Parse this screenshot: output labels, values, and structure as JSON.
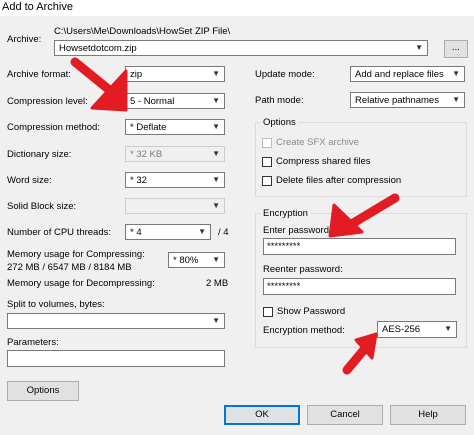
{
  "window": {
    "title": "Add to Archive"
  },
  "archive": {
    "label": "Archive:",
    "path": "C:\\Users\\Me\\Downloads\\HowSet ZIP File\\",
    "filename": "Howsetdotcom.zip",
    "browse_label": "..."
  },
  "left": {
    "format": {
      "label": "Archive format:",
      "value": "zip"
    },
    "level": {
      "label": "Compression level:",
      "value": "5 - Normal"
    },
    "method": {
      "label": "Compression method:",
      "value": "* Deflate"
    },
    "dict": {
      "label": "Dictionary size:",
      "value": "* 32 KB"
    },
    "word": {
      "label": "Word size:",
      "value": "* 32"
    },
    "solid": {
      "label": "Solid Block size:",
      "value": ""
    },
    "threads": {
      "label": "Number of CPU threads:",
      "value": "* 4",
      "max": "/ 4"
    },
    "mem_compress": {
      "label": "Memory usage for Compressing:",
      "detail": "272 MB / 6547 MB / 8184 MB",
      "value": "* 80%"
    },
    "mem_decompress": {
      "label": "Memory usage for Decompressing:",
      "value": "2 MB"
    },
    "split": {
      "label": "Split to volumes, bytes:",
      "value": ""
    },
    "params": {
      "label": "Parameters:",
      "value": ""
    },
    "options_button": "Options"
  },
  "right": {
    "update": {
      "label": "Update mode:",
      "value": "Add and replace files"
    },
    "pathmode": {
      "label": "Path mode:",
      "value": "Relative pathnames"
    },
    "options_group": {
      "title": "Options",
      "sfx": "Create SFX archive",
      "shared": "Compress shared files",
      "delete": "Delete files after compression"
    },
    "encryption": {
      "title": "Encryption",
      "password_label": "Enter password:",
      "password_value": "*********",
      "reenter_label": "Reenter password:",
      "reenter_value": "*********",
      "show_password": "Show Password",
      "method_label": "Encryption method:",
      "method_value": "AES-256"
    }
  },
  "buttons": {
    "ok": "OK",
    "cancel": "Cancel",
    "help": "Help"
  },
  "colors": {
    "annotation_arrow": "#e31b23",
    "default_button_border": "#0078d7"
  }
}
